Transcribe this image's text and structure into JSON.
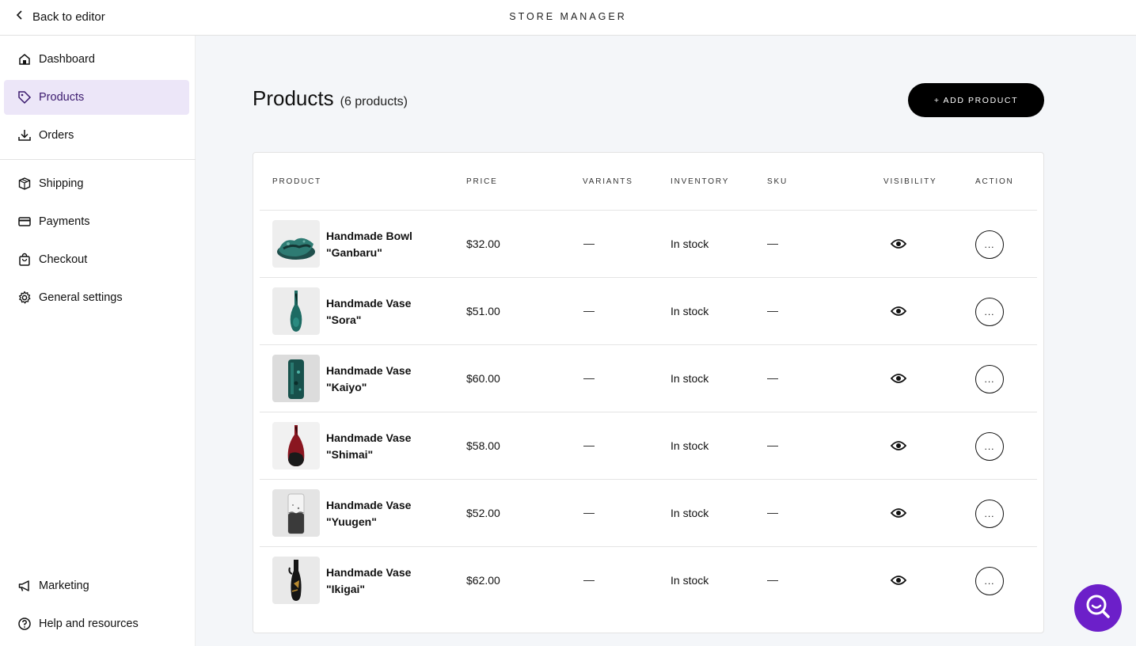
{
  "topbar": {
    "back_label": "Back to editor",
    "brand": "STORE MANAGER"
  },
  "sidebar": {
    "items": [
      {
        "label": "Dashboard",
        "icon": "home-icon"
      },
      {
        "label": "Products",
        "icon": "tag-icon",
        "active": true
      },
      {
        "label": "Orders",
        "icon": "download-icon"
      },
      {
        "label": "Shipping",
        "icon": "box-icon"
      },
      {
        "label": "Payments",
        "icon": "credit-card-icon"
      },
      {
        "label": "Checkout",
        "icon": "shopping-bag-icon"
      },
      {
        "label": "General settings",
        "icon": "gear-icon"
      },
      {
        "label": "Marketing",
        "icon": "megaphone-icon"
      },
      {
        "label": "Help and resources",
        "icon": "help-circle-icon"
      }
    ]
  },
  "main": {
    "title": "Products",
    "count": "(6 products)",
    "add_button": "+ ADD PRODUCT"
  },
  "table": {
    "headers": [
      "PRODUCT",
      "PRICE",
      "VARIANTS",
      "INVENTORY",
      "SKU",
      "VISIBILITY",
      "ACTION"
    ],
    "rows": [
      {
        "name_line1": "Handmade Bowl",
        "name_line2": "\"Ganbaru\"",
        "price": "$32.00",
        "variants": "—",
        "inventory": "In stock",
        "sku": "—",
        "visibility": "eye-icon",
        "action": "..."
      },
      {
        "name_line1": "Handmade Vase",
        "name_line2": "\"Sora\"",
        "price": "$51.00",
        "variants": "—",
        "inventory": "In stock",
        "sku": "—",
        "visibility": "eye-icon",
        "action": "..."
      },
      {
        "name_line1": "Handmade Vase",
        "name_line2": "\"Kaiyo\"",
        "price": "$60.00",
        "variants": "—",
        "inventory": "In stock",
        "sku": "—",
        "visibility": "eye-icon",
        "action": "..."
      },
      {
        "name_line1": "Handmade Vase",
        "name_line2": "\"Shimai\"",
        "price": "$58.00",
        "variants": "—",
        "inventory": "In stock",
        "sku": "—",
        "visibility": "eye-icon",
        "action": "..."
      },
      {
        "name_line1": "Handmade Vase",
        "name_line2": "\"Yuugen\"",
        "price": "$52.00",
        "variants": "—",
        "inventory": "In stock",
        "sku": "—",
        "visibility": "eye-icon",
        "action": "..."
      },
      {
        "name_line1": "Handmade Vase",
        "name_line2": "\"Ikigai\"",
        "price": "$62.00",
        "variants": "—",
        "inventory": "In stock",
        "sku": "—",
        "visibility": "eye-icon",
        "action": "..."
      }
    ]
  },
  "colors": {
    "accent": "#6c1fc9",
    "active_nav_bg": "#ece6f8",
    "main_bg": "#f4f6f9",
    "button_bg": "#000000"
  },
  "help_fab": {
    "icon": "search-chat-icon"
  }
}
